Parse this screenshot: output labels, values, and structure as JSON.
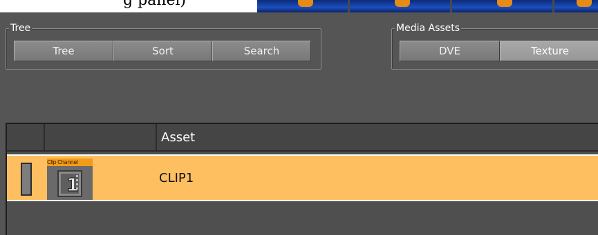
{
  "top_strip": {
    "caption_fragment": "g panel)"
  },
  "thumbnails": {
    "count": 4,
    "accent_color": "#e58b16"
  },
  "tree_group": {
    "title": "Tree",
    "buttons": [
      {
        "label": "Tree"
      },
      {
        "label": "Sort"
      },
      {
        "label": "Search"
      }
    ]
  },
  "media_group": {
    "title": "Media Assets",
    "buttons": [
      {
        "label": "DVE",
        "selected": false
      },
      {
        "label": "Texture",
        "selected": true
      }
    ]
  },
  "table": {
    "columns": [
      {
        "label": ""
      },
      {
        "label": ""
      },
      {
        "label": "Asset"
      }
    ],
    "rows": [
      {
        "thumb_label": "Clip Channel",
        "thumb_icon": "clip-channel-1-icon",
        "asset": "CLIP1",
        "selected": true
      }
    ]
  },
  "colors": {
    "row_selected": "#fdbf60",
    "panel_bg": "#555555"
  }
}
